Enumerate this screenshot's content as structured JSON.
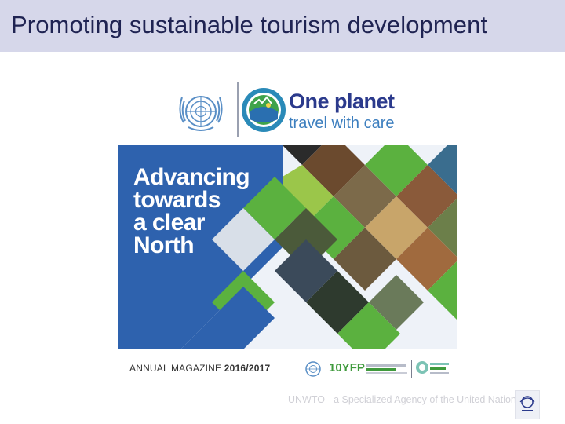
{
  "slide": {
    "title": "Promoting sustainable tourism development",
    "footer": "UNWTO - a Specialized Agency of the United Nations"
  },
  "logo": {
    "title": "One planet",
    "subtitle": "travel with care"
  },
  "cover": {
    "title_lines": [
      "Advancing",
      "towards",
      "a clear",
      "North"
    ],
    "annual_label": "ANNUAL MAGAZINE",
    "annual_year": "2016/2017",
    "partner_text": "10YFP"
  },
  "colors": {
    "title_bar": "#d6d7ea",
    "title_text": "#1f2352",
    "cover_blue": "#2e62ae",
    "cover_green": "#5bb13f",
    "cover_light": "#e9eef6",
    "logo_blue": "#2b3a8c"
  },
  "icons": [
    "un-emblem-icon",
    "one-planet-emblem-icon",
    "unwto-logo-icon"
  ]
}
